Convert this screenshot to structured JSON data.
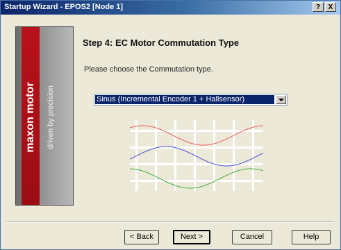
{
  "window": {
    "title": "Startup Wizard - EPOS2 [Node 1]",
    "help_btn": "?",
    "close_btn": "X"
  },
  "sidebar": {
    "brand": "maxon motor",
    "tagline": "driven by precision"
  },
  "content": {
    "step_title": "Step 4: EC Motor Commutation Type",
    "prompt": "Please choose the Commutation type.",
    "commutation": {
      "selected": "Sinus (Incremental Encoder 1 + Hallsensor)"
    },
    "graphic_colors": {
      "grid": "#ffffff",
      "wave1": "#e85a5a",
      "wave2": "#4a4ae0",
      "wave3": "#3fae3f"
    }
  },
  "buttons": {
    "back": "< Back",
    "next": "Next >",
    "cancel": "Cancel",
    "help": "Help"
  }
}
